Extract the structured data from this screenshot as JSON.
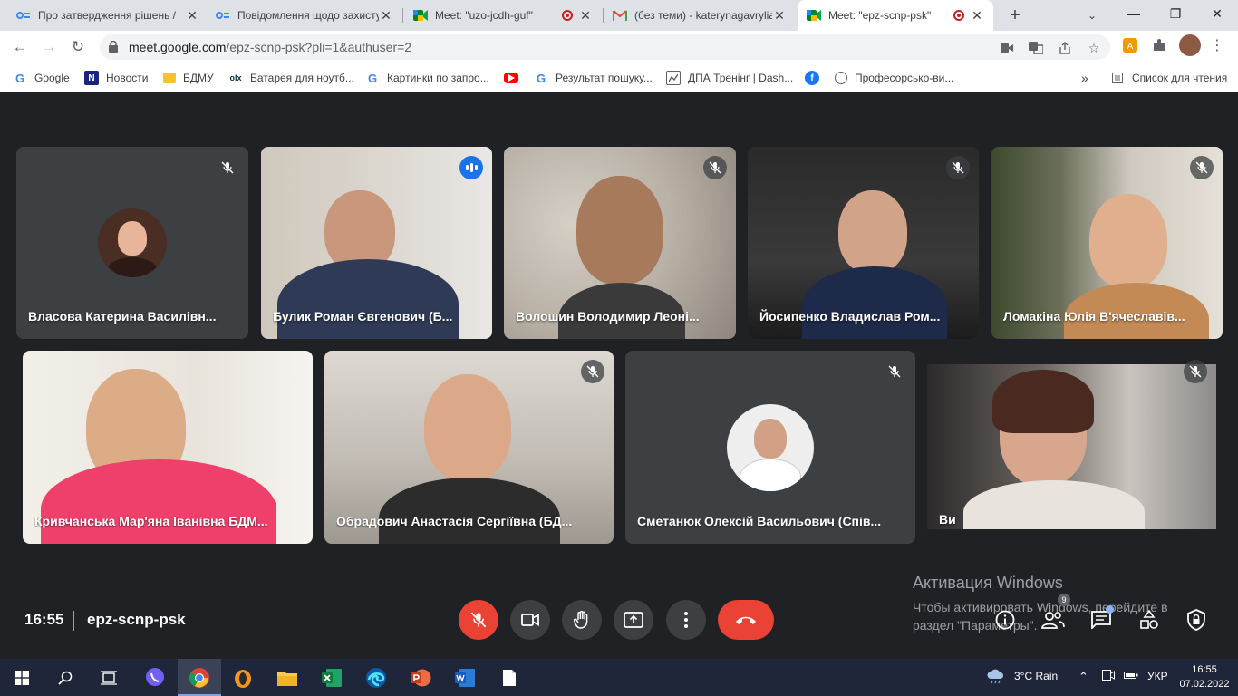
{
  "browser": {
    "tabs": [
      {
        "title": "Про затвердження рішень /",
        "favicon": "google-docs-icon",
        "active": false,
        "recording": false
      },
      {
        "title": "Повідомлення щодо захисту",
        "favicon": "google-docs-icon",
        "active": false,
        "recording": false
      },
      {
        "title": "Meet: \"uzo-jcdh-guf\"",
        "favicon": "meet-icon",
        "active": false,
        "recording": true
      },
      {
        "title": "(без теми) - katerynagavrylia",
        "favicon": "gmail-icon",
        "active": false,
        "recording": false
      },
      {
        "title": "Meet: \"epz-scnp-psk\"",
        "favicon": "meet-icon",
        "active": true,
        "recording": true
      }
    ],
    "url_host": "meet.google.com",
    "url_path": "/epz-scnp-psk?pli=1&authuser=2",
    "bookmarks": [
      {
        "label": "Google",
        "icon": "google-icon"
      },
      {
        "label": "Новости",
        "icon": "news-icon"
      },
      {
        "label": "БДМУ",
        "icon": "folder-icon"
      },
      {
        "label": "Батарея для ноутб...",
        "icon": "olx-icon"
      },
      {
        "label": "Картинки по запро...",
        "icon": "google-icon"
      },
      {
        "label": "",
        "icon": "youtube-icon"
      },
      {
        "label": "Результат пошуку...",
        "icon": "google-icon"
      },
      {
        "label": "ДПА Тренінг | Dash...",
        "icon": "dashboard-icon"
      },
      {
        "label": "",
        "icon": "facebook-icon"
      },
      {
        "label": "Професорсько-ви...",
        "icon": "globe-icon"
      }
    ],
    "more_bookmarks": "»",
    "reading_list": "Список для чтения"
  },
  "meet": {
    "participants_row1": [
      {
        "name": "Власова Катерина Василівн...",
        "kind": "avatar",
        "muted": true,
        "speaking": false
      },
      {
        "name": "Булик Роман Євгенович (Б...",
        "kind": "video",
        "muted": false,
        "speaking": true
      },
      {
        "name": "Волошин Володимир Леоні...",
        "kind": "video",
        "muted": true,
        "speaking": false
      },
      {
        "name": "Йосипенко Владислав Ром...",
        "kind": "video",
        "muted": true,
        "speaking": false
      },
      {
        "name": "Ломакіна Юлія В'ячеславів...",
        "kind": "video",
        "muted": true,
        "speaking": false
      }
    ],
    "participants_row2": [
      {
        "name": "Кривчанська Мар'яна Іванівна БДМ...",
        "kind": "video",
        "muted": false,
        "speaking": false
      },
      {
        "name": "Обрадович Анастасія Сергіївна (БД...",
        "kind": "video",
        "muted": true,
        "speaking": false
      },
      {
        "name": "Сметанюк Олексій Васильович (Спів...",
        "kind": "avatar",
        "muted": true,
        "speaking": false
      },
      {
        "name": "Ви",
        "kind": "video",
        "muted": true,
        "speaking": false
      }
    ],
    "time": "16:55",
    "meeting_code": "epz-scnp-psk",
    "people_badge": "9",
    "colors": {
      "accent": "#8ab4f8",
      "danger": "#ea4335",
      "surface": "#3c4043",
      "background": "#202124"
    }
  },
  "watermark": {
    "title": "Активация Windows",
    "line1": "Чтобы активировать Windows, перейдите в",
    "line2": "раздел \"Параметры\"."
  },
  "taskbar": {
    "weather": "3°C  Rain",
    "language": "УКР",
    "time": "16:55",
    "date": "07.02.2022"
  }
}
